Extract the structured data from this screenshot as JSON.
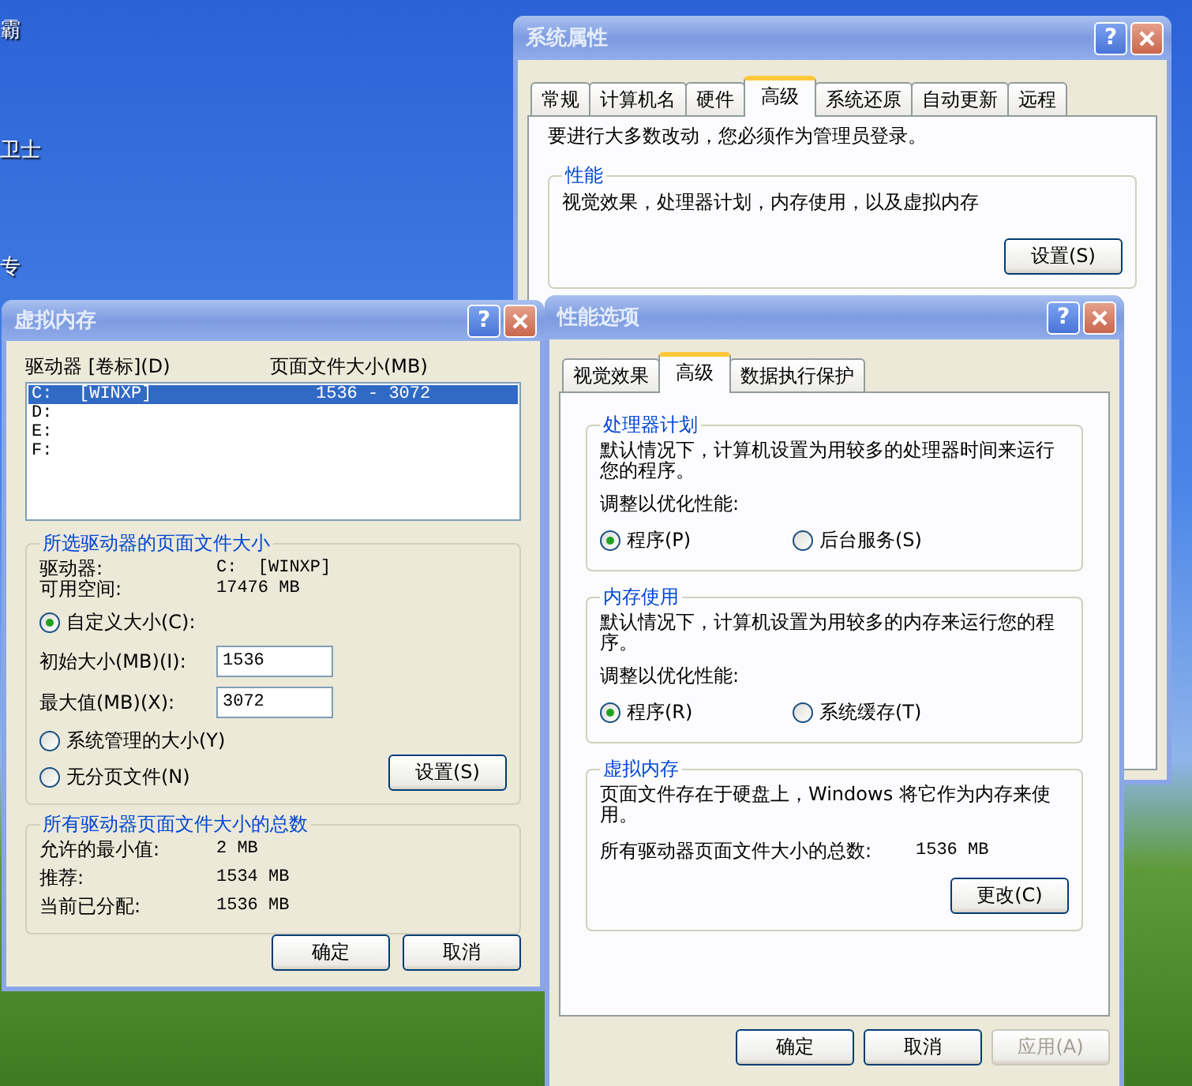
{
  "desktop_labels": [
    "霸",
    "卫士",
    "专"
  ],
  "system_properties": {
    "title": "系统属性",
    "help_button": "?",
    "tabs": [
      {
        "label": "常规",
        "selected": false
      },
      {
        "label": "计算机名",
        "selected": false
      },
      {
        "label": "硬件",
        "selected": false
      },
      {
        "label": "高级",
        "selected": true
      },
      {
        "label": "系统还原",
        "selected": false
      },
      {
        "label": "自动更新",
        "selected": false
      },
      {
        "label": "远程",
        "selected": false
      }
    ],
    "notice": "要进行大多数改动，您必须作为管理员登录。",
    "performance": {
      "title": "性能",
      "description": "视觉效果，处理器计划，内存使用，以及虚拟内存",
      "button": "设置(S)"
    }
  },
  "virtual_memory": {
    "title": "虚拟内存",
    "help_button": "?",
    "list_headers": [
      "驱动器 [卷标](D)",
      "页面文件大小(MB)"
    ],
    "drives": [
      {
        "drive": "C:",
        "label": "[WINXP]",
        "size": "1536 - 3072",
        "selected": true
      },
      {
        "drive": "D:",
        "selected": false
      },
      {
        "drive": "E:",
        "selected": false
      },
      {
        "drive": "F:",
        "selected": false
      }
    ],
    "selected_drive": {
      "title": "所选驱动器的页面文件大小",
      "drive_label": "驱动器:",
      "drive_value": "C:  [WINXP]",
      "space_label": "可用空间:",
      "space_value": "17476 MB",
      "size_options": [
        {
          "label": "自定义大小(C):",
          "selected": true
        },
        {
          "label": "系统管理的大小(Y)",
          "selected": false
        },
        {
          "label": "无分页文件(N)",
          "selected": false
        }
      ],
      "initial_label": "初始大小(MB)(I):",
      "initial_value": "1536",
      "max_label": "最大值(MB)(X):",
      "max_value": "3072",
      "button": "设置(S)"
    },
    "totals": {
      "title": "所有驱动器页面文件大小的总数",
      "rows": [
        {
          "label": "允许的最小值:",
          "value": "2 MB"
        },
        {
          "label": "推荐:",
          "value": "1534 MB"
        },
        {
          "label": "当前已分配:",
          "value": "1536 MB"
        }
      ]
    },
    "buttons": [
      "确定",
      "取消"
    ]
  },
  "performance_options": {
    "title": "性能选项",
    "help_button": "?",
    "tabs": [
      {
        "label": "视觉效果",
        "selected": false
      },
      {
        "label": "高级",
        "selected": true
      },
      {
        "label": "数据执行保护",
        "selected": false
      }
    ],
    "processor": {
      "title": "处理器计划",
      "description": "默认情况下，计算机设置为用较多的处理器时间来运行您的程序。",
      "adjust_label": "调整以优化性能:",
      "options": [
        {
          "label": "程序(P)",
          "selected": true
        },
        {
          "label": "后台服务(S)",
          "selected": false
        }
      ]
    },
    "memory": {
      "title": "内存使用",
      "description": "默认情况下，计算机设置为用较多的内存来运行您的程序。",
      "adjust_label": "调整以优化性能:",
      "options": [
        {
          "label": "程序(R)",
          "selected": true
        },
        {
          "label": "系统缓存(T)",
          "selected": false
        }
      ]
    },
    "virtual_memory": {
      "title": "虚拟内存",
      "description": "页面文件存在于硬盘上，Windows 将它作为内存来使用。",
      "total_label": "所有驱动器页面文件大小的总数:",
      "total_value": "1536 MB",
      "button": "更改(C)"
    },
    "buttons": [
      {
        "label": "确定",
        "disabled": false
      },
      {
        "label": "取消",
        "disabled": false
      },
      {
        "label": "应用(A)",
        "disabled": true
      }
    ]
  }
}
